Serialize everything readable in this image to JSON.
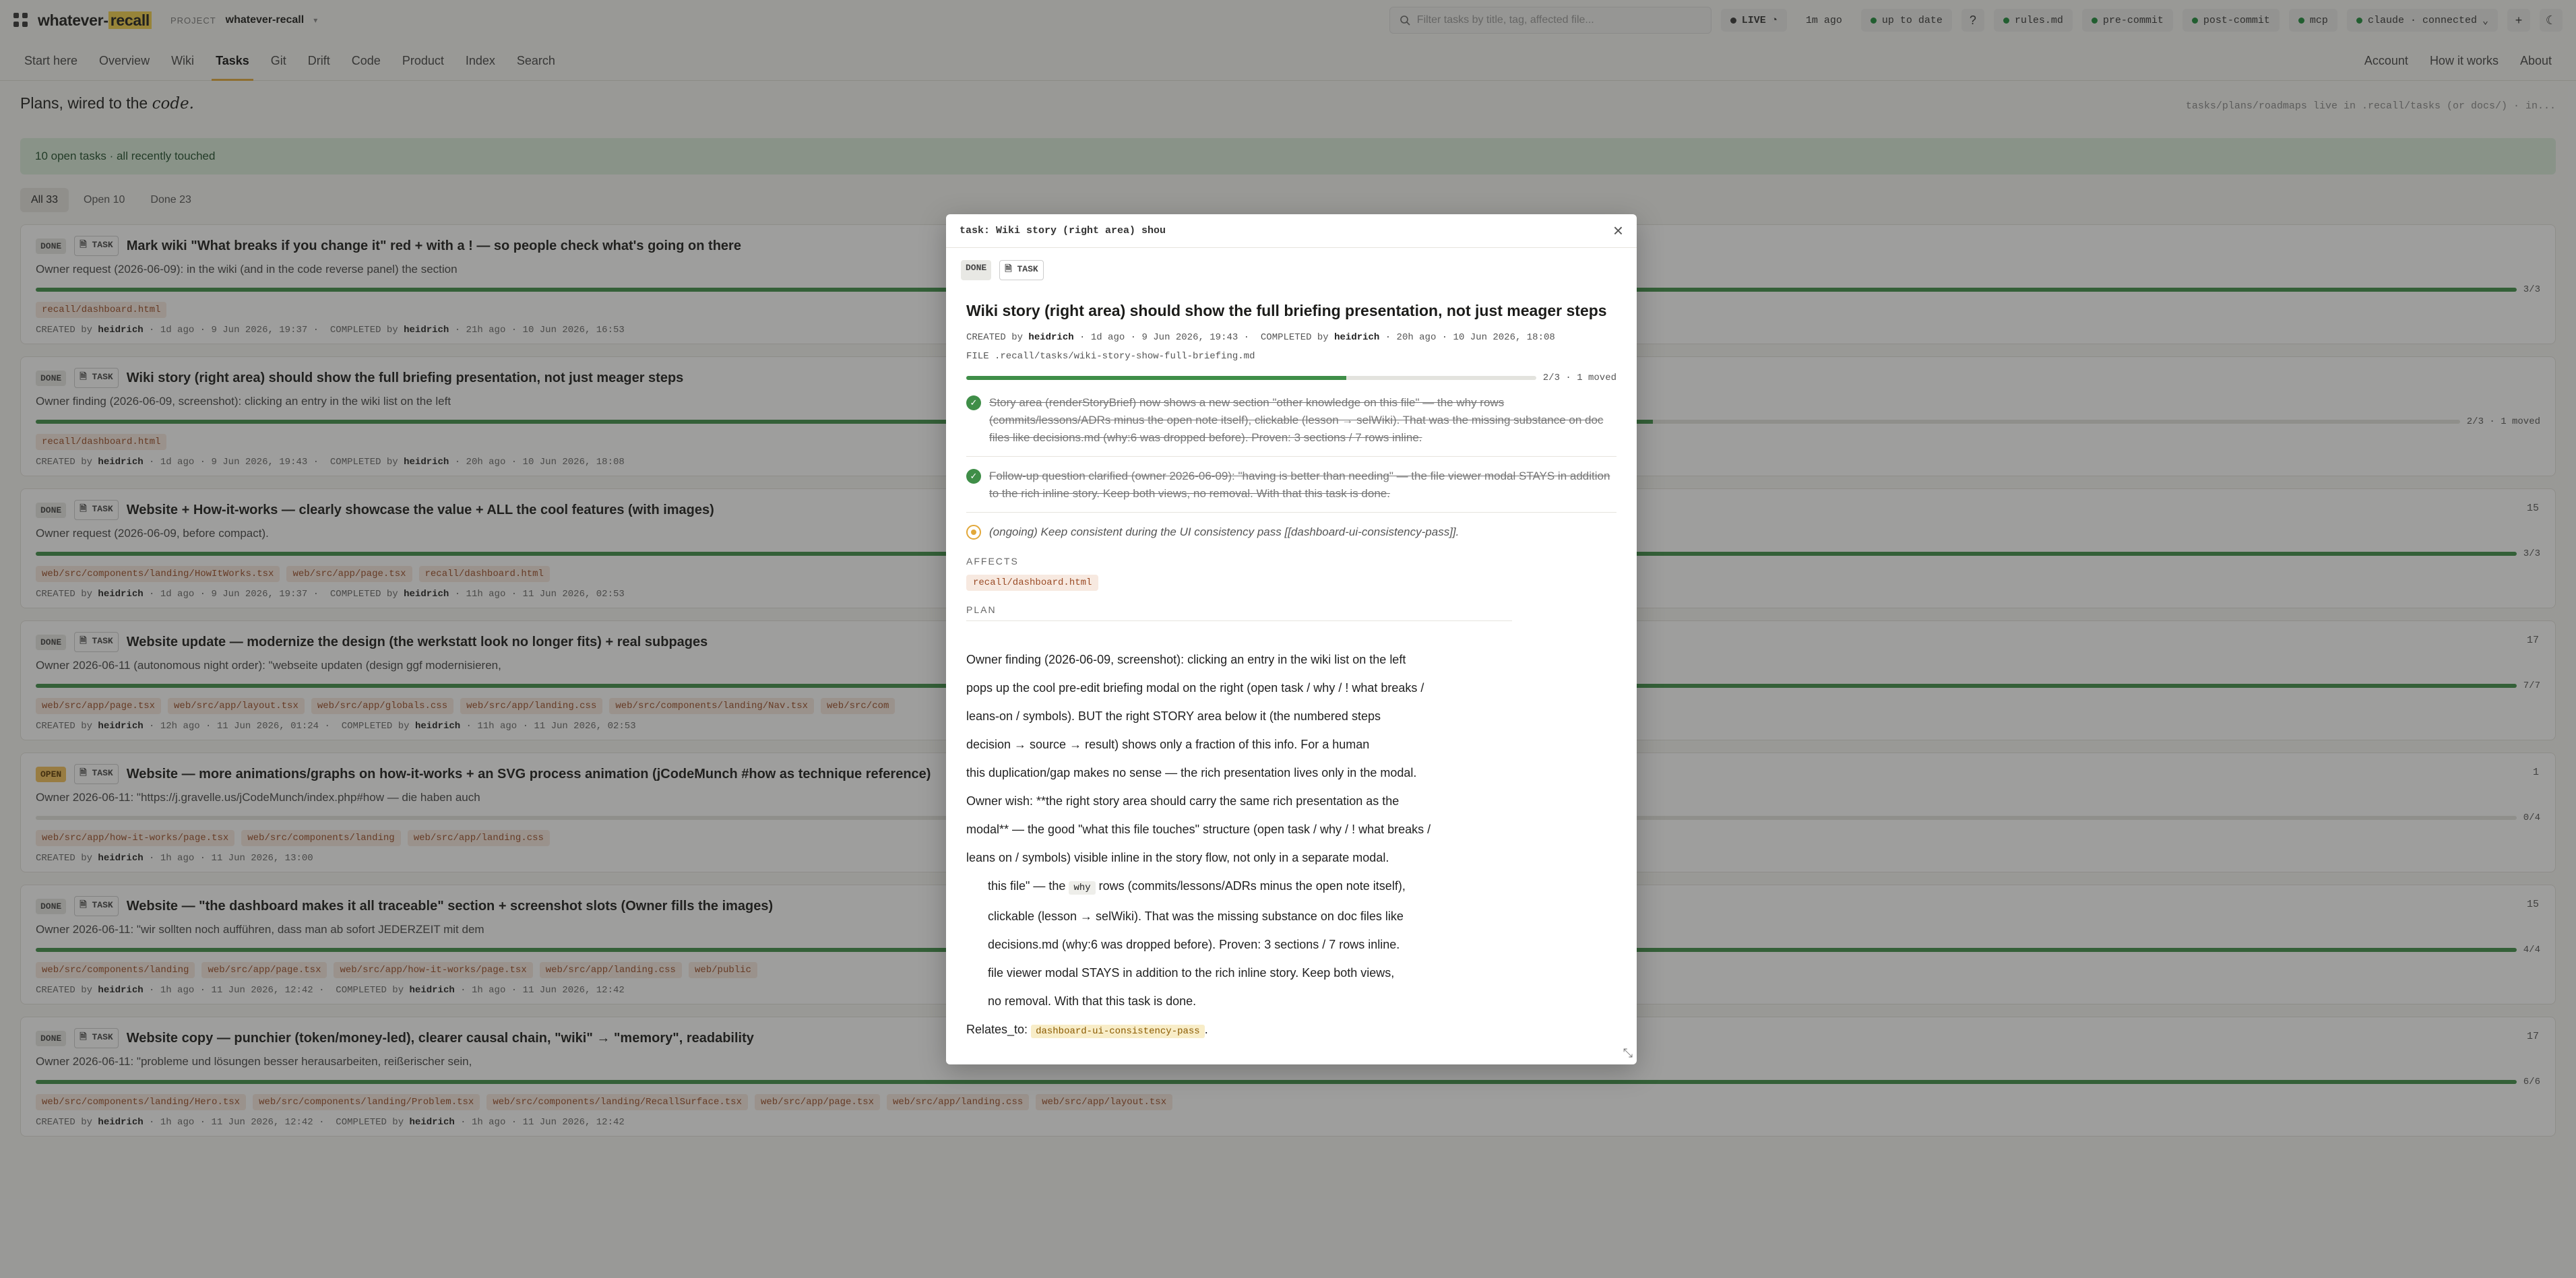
{
  "app": {
    "logo_prefix": "whatever-",
    "logo_highlight": "recall",
    "project_label": "PROJECT",
    "project_name": "whatever-recall",
    "search_placeholder": "Filter tasks by title, tag, affected file...",
    "live_label": "LIVE",
    "updated": "1m ago",
    "status": "up to date",
    "help": "?",
    "rules": "rules.md",
    "pre_commit": "pre-commit",
    "post_commit": "post-commit",
    "mcp": "mcp",
    "claude": "claude · connected",
    "plus": "+",
    "theme_icon": "moon-icon"
  },
  "nav": {
    "items": [
      "Start here",
      "Overview",
      "Wiki",
      "Tasks",
      "Git",
      "Drift",
      "Code",
      "Product",
      "Index",
      "Search"
    ],
    "active": "Tasks",
    "right": [
      "Account",
      "How it works",
      "About"
    ]
  },
  "page": {
    "title_main": "Plans, wired to the ",
    "title_em": "code.",
    "hint": "tasks/plans/roadmaps live in .recall/tasks (or docs/) · in...",
    "banner": "10 open tasks · all recently touched",
    "filters": [
      "All 33",
      "Open 10",
      "Done 23"
    ]
  },
  "tasks": [
    {
      "status": "DONE",
      "kind": "TASK",
      "title": "Mark wiki \"What breaks if you change it\" red + with a ! — so people check what's going on there",
      "sub": "Owner request (2026-06-09): in the wiki (and in the code reverse panel) the section",
      "count": "",
      "progress": 1.0,
      "progress_label": "3/3",
      "files": [
        "recall/dashboard.html"
      ],
      "meta_created": "CREATED by",
      "meta_created_by": "heidrich",
      "meta_created_when": " · 1d ago · 9 Jun 2026, 19:37",
      "meta_completed": "COMPLETED by",
      "meta_completed_by": "heidrich",
      "meta_completed_when": " · 21h ago · 10 Jun 2026, 16:53"
    },
    {
      "status": "DONE",
      "kind": "TASK",
      "title": "Wiki story (right area) should show the full briefing presentation, not just meager steps",
      "sub": "Owner finding (2026-06-09, screenshot): clicking an entry in the wiki list on the left",
      "count": "",
      "progress": 0.667,
      "progress_label": "2/3 · 1 moved",
      "files": [
        "recall/dashboard.html"
      ],
      "meta_created": "CREATED by",
      "meta_created_by": "heidrich",
      "meta_created_when": " · 1d ago · 9 Jun 2026, 19:43",
      "meta_completed": "COMPLETED by",
      "meta_completed_by": "heidrich",
      "meta_completed_when": " · 20h ago · 10 Jun 2026, 18:08"
    },
    {
      "status": "DONE",
      "kind": "TASK",
      "title": "Website + How-it-works — clearly showcase the value + ALL the cool features (with images)",
      "sub": "Owner request (2026-06-09, before compact).",
      "count": "15",
      "progress": 1.0,
      "progress_label": "3/3",
      "files": [
        "web/src/components/landing/HowItWorks.tsx",
        "web/src/app/page.tsx",
        "recall/dashboard.html"
      ],
      "meta_created": "CREATED by",
      "meta_created_by": "heidrich",
      "meta_created_when": " · 1d ago · 9 Jun 2026, 19:37",
      "meta_completed": "COMPLETED by",
      "meta_completed_by": "heidrich",
      "meta_completed_when": " · 11h ago · 11 Jun 2026, 02:53"
    },
    {
      "status": "DONE",
      "kind": "TASK",
      "title": "Website update — modernize the design (the werkstatt look no longer fits) + real subpages",
      "sub": "Owner 2026-06-11 (autonomous night order): \"webseite updaten (design ggf modernisieren,",
      "count": "17",
      "progress": 1.0,
      "progress_label": "7/7",
      "files": [
        "web/src/app/page.tsx",
        "web/src/app/layout.tsx",
        "web/src/app/globals.css",
        "web/src/app/landing.css",
        "web/src/components/landing/Nav.tsx",
        "web/src/com"
      ],
      "meta_created": "CREATED by",
      "meta_created_by": "heidrich",
      "meta_created_when": " · 12h ago · 11 Jun 2026, 01:24",
      "meta_completed": "COMPLETED by",
      "meta_completed_by": "heidrich",
      "meta_completed_when": " · 11h ago · 11 Jun 2026, 02:53"
    },
    {
      "status": "OPEN",
      "kind": "TASK",
      "title": "Website — more animations/graphs on how-it-works + an SVG process animation (jCodeMunch #how as technique reference)",
      "sub": "Owner 2026-06-11: \"https://j.gravelle.us/jCodeMunch/index.php#how — die haben auch",
      "count": "1",
      "progress": 0.0,
      "progress_label": "0/4",
      "files": [
        "web/src/app/how-it-works/page.tsx",
        "web/src/components/landing",
        "web/src/app/landing.css"
      ],
      "meta_created": "CREATED by",
      "meta_created_by": "heidrich",
      "meta_created_when": " · 1h ago · 11 Jun 2026, 13:00",
      "meta_completed": "",
      "meta_completed_by": "",
      "meta_completed_when": ""
    },
    {
      "status": "DONE",
      "kind": "TASK",
      "title": "Website — \"the dashboard makes it all traceable\" section + screenshot slots (Owner fills the images)",
      "sub": "Owner 2026-06-11: \"wir sollten noch aufführen, dass man ab sofort JEDERZEIT mit dem",
      "count": "15",
      "progress": 1.0,
      "progress_label": "4/4",
      "files": [
        "web/src/components/landing",
        "web/src/app/page.tsx",
        "web/src/app/how-it-works/page.tsx",
        "web/src/app/landing.css",
        "web/public"
      ],
      "meta_created": "CREATED by",
      "meta_created_by": "heidrich",
      "meta_created_when": " · 1h ago · 11 Jun 2026, 12:42",
      "meta_completed": "COMPLETED by",
      "meta_completed_by": "heidrich",
      "meta_completed_when": " · 1h ago · 11 Jun 2026, 12:42"
    },
    {
      "status": "DONE",
      "kind": "TASK",
      "title": "Website copy — punchier (token/money-led), clearer causal chain, \"wiki\" → \"memory\", readability",
      "sub": "Owner 2026-06-11: \"probleme und lösungen besser herausarbeiten, reißerischer sein,",
      "count": "17",
      "progress": 1.0,
      "progress_label": "6/6",
      "files": [
        "web/src/components/landing/Hero.tsx",
        "web/src/components/landing/Problem.tsx",
        "web/src/components/landing/RecallSurface.tsx",
        "web/src/app/page.tsx",
        "web/src/app/landing.css",
        "web/src/app/layout.tsx"
      ],
      "meta_created": "CREATED by",
      "meta_created_by": "heidrich",
      "meta_created_when": " · 1h ago · 11 Jun 2026, 12:42",
      "meta_completed": "COMPLETED by",
      "meta_completed_by": "heidrich",
      "meta_completed_when": " · 1h ago · 11 Jun 2026, 12:42"
    }
  ],
  "modal": {
    "top_title": "task: Wiki story (right area) shou",
    "status": "DONE",
    "kind": "TASK",
    "title": "Wiki story (right area) should show the full briefing presentation, not just meager steps",
    "created_label": "CREATED by",
    "created_by": "heidrich",
    "created_when": " · 1d ago · 9 Jun 2026, 19:43",
    "completed_label": "COMPLETED by",
    "completed_by": "heidrich",
    "completed_when": " · 20h ago · 10 Jun 2026, 18:08",
    "file_line": "FILE .recall/tasks/wiki-story-show-full-briefing.md",
    "progress": 0.667,
    "progress_label": "2/3 · 1 moved",
    "steps": [
      {
        "state": "done",
        "text": "Story area (renderStoryBrief) now shows a new section \"other knowledge on this file\" — the why rows (commits/lessons/ADRs minus the open note itself), clickable (lesson → selWiki). That was the missing substance on doc files like decisions.md (why:6 was dropped before). Proven: 3 sections / 7 rows inline."
      },
      {
        "state": "done",
        "text": "Follow-up question clarified (owner 2026-06-09): \"having is better than needing\" — the file viewer modal STAYS in addition to the rich inline story. Keep both views, no removal. With that this task is done."
      },
      {
        "state": "ongoing",
        "text": "(ongoing) Keep consistent during the UI consistency pass [[dashboard-ui-consistency-pass]]."
      }
    ],
    "affects_label": "AFFECTS",
    "affects_file": "recall/dashboard.html",
    "plan_label": "PLAN",
    "plan_lines": [
      "Owner finding (2026-06-09, screenshot): clicking an entry in the wiki list on the left",
      "pops up the cool pre-edit briefing modal on the right (open task / why / ! what breaks /",
      "leans-on / symbols). BUT the right STORY area below it (the numbered steps",
      "decision → source → result) shows only a fraction of this info. For a human",
      "this duplication/gap makes no sense — the rich presentation lives only in the modal.",
      "Owner wish: **the right story area should carry the same rich presentation as the",
      "modal** — the good \"what this file touches\" structure (open task / why / ! what breaks /",
      "leans on / symbols) visible inline in the story flow, not only in a separate modal."
    ],
    "plan_indent_a": "this file\" — the ",
    "plan_code_why": "why",
    "plan_indent_b": " rows (commits/lessons/ADRs minus the open note itself),",
    "plan_indent_lines": [
      "clickable (lesson → selWiki). That was the missing substance on doc files like",
      "decisions.md (why:6 was dropped before). Proven: 3 sections / 7 rows inline.",
      "file viewer modal STAYS in addition to the rich inline story. Keep both views,",
      "no removal. With that this task is done."
    ],
    "relates_label": "Relates_to: ",
    "relates_value": "dashboard-ui-consistency-pass",
    "relates_tail": "."
  }
}
